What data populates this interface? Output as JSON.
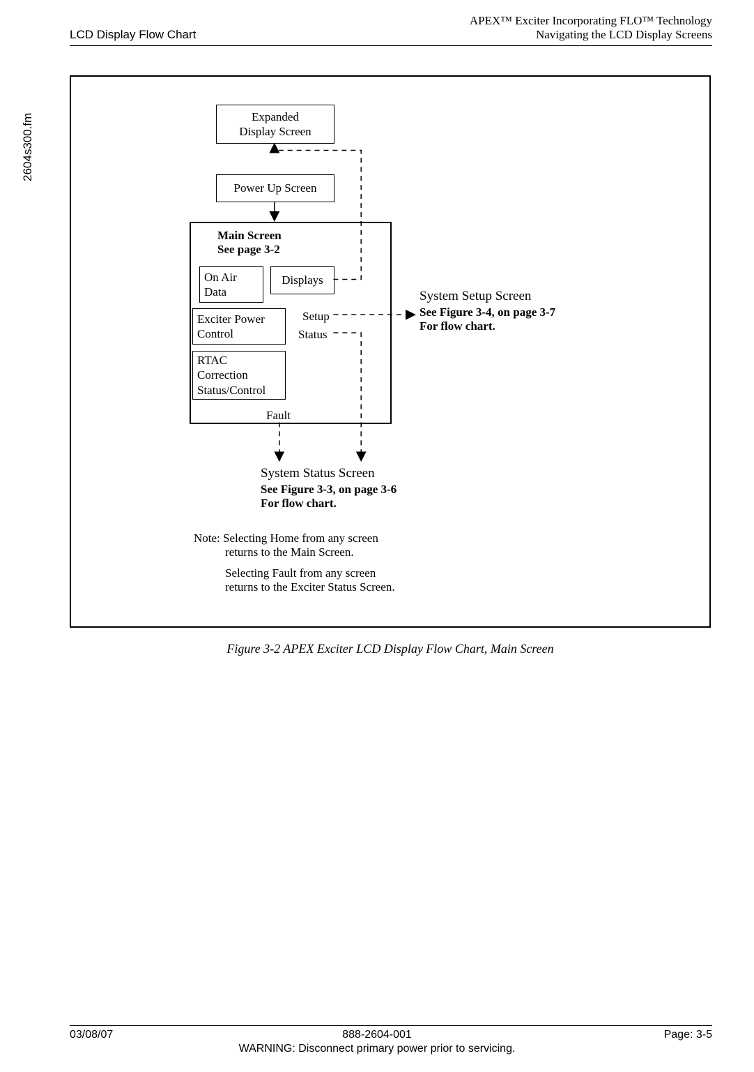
{
  "header": {
    "left": "LCD Display Flow Chart",
    "right_top": "APEX™ Exciter Incorporating FLO™ Technology",
    "right_bot": "Navigating the LCD Display Screens"
  },
  "side_filename": "2604s300.fm",
  "boxes": {
    "expanded": "Expanded\nDisplay Screen",
    "powerup": "Power Up Screen",
    "main_title_l1": "Main Screen",
    "main_title_l2": "See page 3-2",
    "onair_l1": "On Air",
    "onair_l2": "Data",
    "displays": "Displays",
    "exciter_l1": "Exciter Power",
    "exciter_l2": "Control",
    "rtac_l1": "RTAC",
    "rtac_l2": "Correction",
    "rtac_l3": "Status/Control"
  },
  "labels": {
    "setup": "Setup",
    "status": "Status",
    "fault": "Fault"
  },
  "sys_status": {
    "title": "System Status Screen",
    "sub1": "See Figure 3-3, on page 3-6",
    "sub2": "For flow chart."
  },
  "sys_setup": {
    "title": "System Setup Screen",
    "sub1": "See Figure 3-4, on page 3-7",
    "sub2": "For flow chart."
  },
  "notes": {
    "n1a": "Note: Selecting Home from any screen",
    "n1b": "returns to the Main Screen.",
    "n2a": "Selecting Fault from any screen",
    "n2b": "returns to the Exciter Status Screen."
  },
  "figure_caption": "Figure 3-2  APEX Exciter LCD Display Flow Chart, Main Screen",
  "footer": {
    "left": "03/08/07",
    "mid": "888-2604-001",
    "right": "Page: 3-5",
    "warn": "WARNING: Disconnect primary power prior to servicing."
  }
}
